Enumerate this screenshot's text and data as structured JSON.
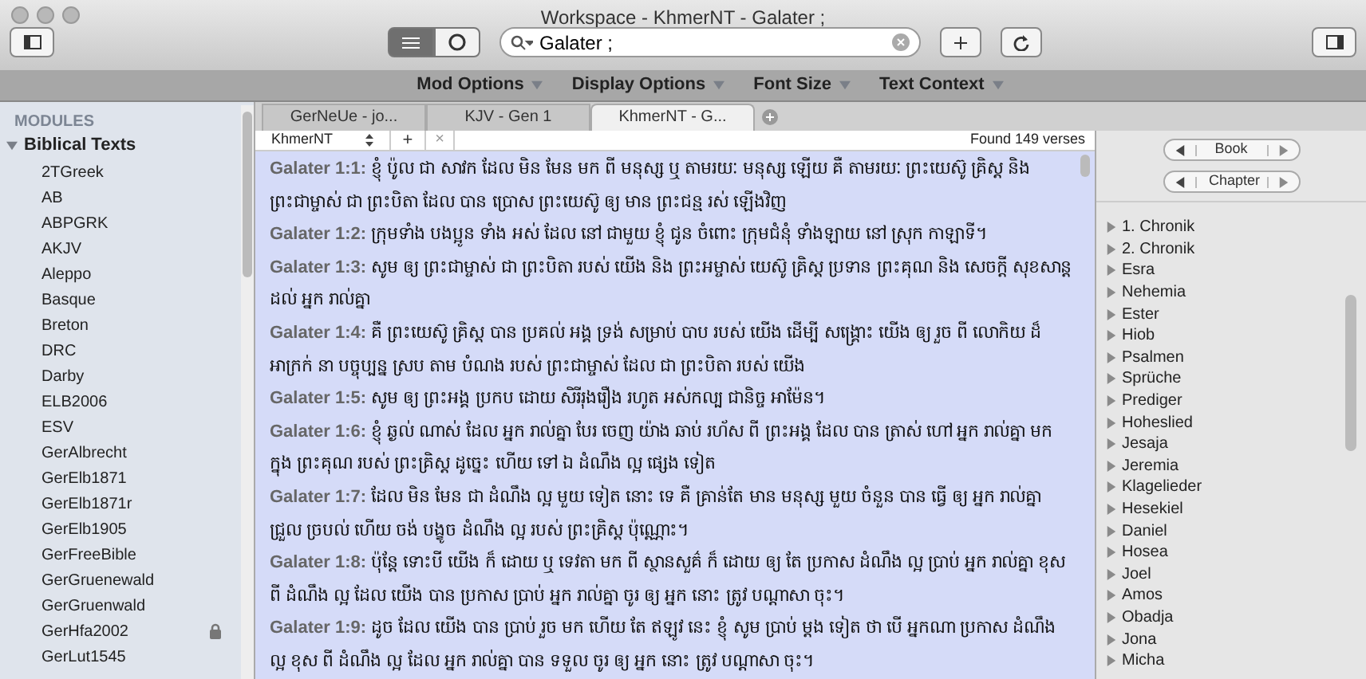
{
  "window": {
    "title": "Workspace - KhmerNT - Galater ;"
  },
  "toolbar": {
    "search": {
      "value": "Galater ;"
    },
    "view_toggle": [
      {
        "selected": true
      },
      {
        "selected": false
      }
    ]
  },
  "menu": [
    "Mod Options",
    "Display Options",
    "Font Size",
    "Text Context"
  ],
  "sidebar": {
    "header": "MODULES",
    "group": {
      "label": "Biblical Texts",
      "expanded": true,
      "children": [
        {
          "label": "2TGreek",
          "locked": false
        },
        {
          "label": "AB",
          "locked": false
        },
        {
          "label": "ABPGRK",
          "locked": false
        },
        {
          "label": "AKJV",
          "locked": false
        },
        {
          "label": "Aleppo",
          "locked": false
        },
        {
          "label": "Basque",
          "locked": false
        },
        {
          "label": "Breton",
          "locked": false
        },
        {
          "label": "DRC",
          "locked": false
        },
        {
          "label": "Darby",
          "locked": false
        },
        {
          "label": "ELB2006",
          "locked": false
        },
        {
          "label": "ESV",
          "locked": false
        },
        {
          "label": "GerAlbrecht",
          "locked": false
        },
        {
          "label": "GerElb1871",
          "locked": false
        },
        {
          "label": "GerElb1871r",
          "locked": false
        },
        {
          "label": "GerElb1905",
          "locked": false
        },
        {
          "label": "GerFreeBible",
          "locked": false
        },
        {
          "label": "GerGruenewald",
          "locked": false
        },
        {
          "label": "GerGruenwald",
          "locked": false
        },
        {
          "label": "GerHfa2002",
          "locked": true
        },
        {
          "label": "GerLut1545",
          "locked": false
        }
      ]
    }
  },
  "tabs": [
    {
      "label": "GerNeUe - jo...",
      "selected": false
    },
    {
      "label": "KJV - Gen 1",
      "selected": false
    },
    {
      "label": "KhmerNT - G...",
      "selected": true
    }
  ],
  "module_bar": {
    "module": "KhmerNT",
    "add": "+",
    "close": "×",
    "status": "Found 149 verses"
  },
  "verses": [
    {
      "ref": "Galater 1:1:",
      "text": "ខ្ញុំ ប៉ូល ជា សាវក ដែល មិន មែន មក ពី មនុស្ស ឬ តាមរយៈ មនុស្ស ឡើយ គឺ តាមរយៈ ព្រះយេស៊ូ គ្រិស្ត និង ព្រះជាម្ចាស់ ជា ព្រះបិតា ដែល បាន ប្រោស ព្រះយេស៊ូ ឲ្យ មាន ព្រះជន្ម រស់ ឡើងវិញ"
    },
    {
      "ref": "Galater 1:2:",
      "text": "ក្រុមទាំង បងប្អូន ទាំង អស់ ដែល នៅ ជាមួយ ខ្ញុំ ជូន ចំពោះ ក្រុមជំនុំ ទាំងឡាយ នៅ ស្រុក កាឡាទី។"
    },
    {
      "ref": "Galater 1:3:",
      "text": "សូម ឲ្យ ព្រះជាម្ចាស់ ជា ព្រះបិតា របស់ យើង និង ព្រះអម្ចាស់ យេស៊ូ គ្រិស្ត ប្រទាន ព្រះគុណ និង សេចក្ដី សុខសាន្ត ដល់ អ្នក រាល់គ្នា"
    },
    {
      "ref": "Galater 1:4:",
      "text": "គឺ ព្រះយេស៊ូ គ្រិស្ត បាន ប្រគល់ អង្គ ទ្រង់ សម្រាប់ បាប របស់ យើង ដើម្បី សង្គ្រោះ យើង ឲ្យ រួច ពី លោកិយ ដ៏ អាក្រក់ នា បច្ចុប្បន្ន ស្រប តាម បំណង របស់ ព្រះជាម្ចាស់ ដែល ជា ព្រះបិតា របស់ យើង"
    },
    {
      "ref": "Galater 1:5:",
      "text": "សូម ឲ្យ ព្រះអង្គ ប្រកប ដោយ សិរីរុងរឿង រហូត អស់កល្ប ជានិច្ច អាម៉ែន។"
    },
    {
      "ref": "Galater 1:6:",
      "text": "ខ្ញុំ ឆ្ងល់ ណាស់ ដែល អ្នក រាល់គ្នា បែរ ចេញ យ៉ាង ឆាប់ រហ័ស ពី ព្រះអង្គ ដែល បាន ត្រាស់ ហៅ អ្នក រាល់គ្នា មក ក្នុង ព្រះគុណ របស់ ព្រះគ្រិស្ត ដូច្នេះ ហើយ ទៅ ឯ ដំណឹង ល្អ ផ្សេង ទៀត"
    },
    {
      "ref": "Galater 1:7:",
      "text": "ដែល មិន មែន ជា ដំណឹង ល្អ មួយ ទៀត នោះ ទេ គឺ គ្រាន់តែ មាន មនុស្ស មួយ ចំនួន បាន ធ្វើ ឲ្យ អ្នក រាល់គ្នា ជ្រួល ច្របល់ ហើយ ចង់ បង្ខូច ដំណឹង ល្អ របស់ ព្រះគ្រិស្ត ប៉ុណ្ណោះ។"
    },
    {
      "ref": "Galater 1:8:",
      "text": "ប៉ុន្ដែ ទោះបី យើង ក៏ ដោយ ឬ ទេវតា មក ពី ស្ថានសួគ៌ ក៏ ដោយ ឲ្យ តែ ប្រកាស ដំណឹង ល្អ ប្រាប់ អ្នក រាល់គ្នា ខុស ពី ដំណឹង ល្អ ដែល យើង បាន ប្រកាស ប្រាប់ អ្នក រាល់គ្នា ចូរ ឲ្យ អ្នក នោះ ត្រូវ បណ្ដាសា ចុះ។"
    },
    {
      "ref": "Galater 1:9:",
      "text": "ដូច ដែល យើង បាន ប្រាប់ រួច មក ហើយ តែ ឥឡូវ នេះ ខ្ញុំ សូម ប្រាប់ ម្ដង ទៀត ថា បើ អ្នកណា ប្រកាស ដំណឹង ល្អ ខុស ពី ដំណឹង ល្អ ដែល អ្នក រាល់គ្នា បាន ទទួល ចូរ ឲ្យ អ្នក នោះ ត្រូវ បណ្ដាសា ចុះ។"
    }
  ],
  "navigator": {
    "book": "Book",
    "chapter": "Chapter",
    "books": [
      "1. Chronik",
      "2. Chronik",
      "Esra",
      "Nehemia",
      "Ester",
      "Hiob",
      "Psalmen",
      "Sprüche",
      "Prediger",
      "Hoheslied",
      "Jesaja",
      "Jeremia",
      "Klagelieder",
      "Hesekiel",
      "Daniel",
      "Hosea",
      "Joel",
      "Amos",
      "Obadja",
      "Jona",
      "Micha"
    ]
  }
}
